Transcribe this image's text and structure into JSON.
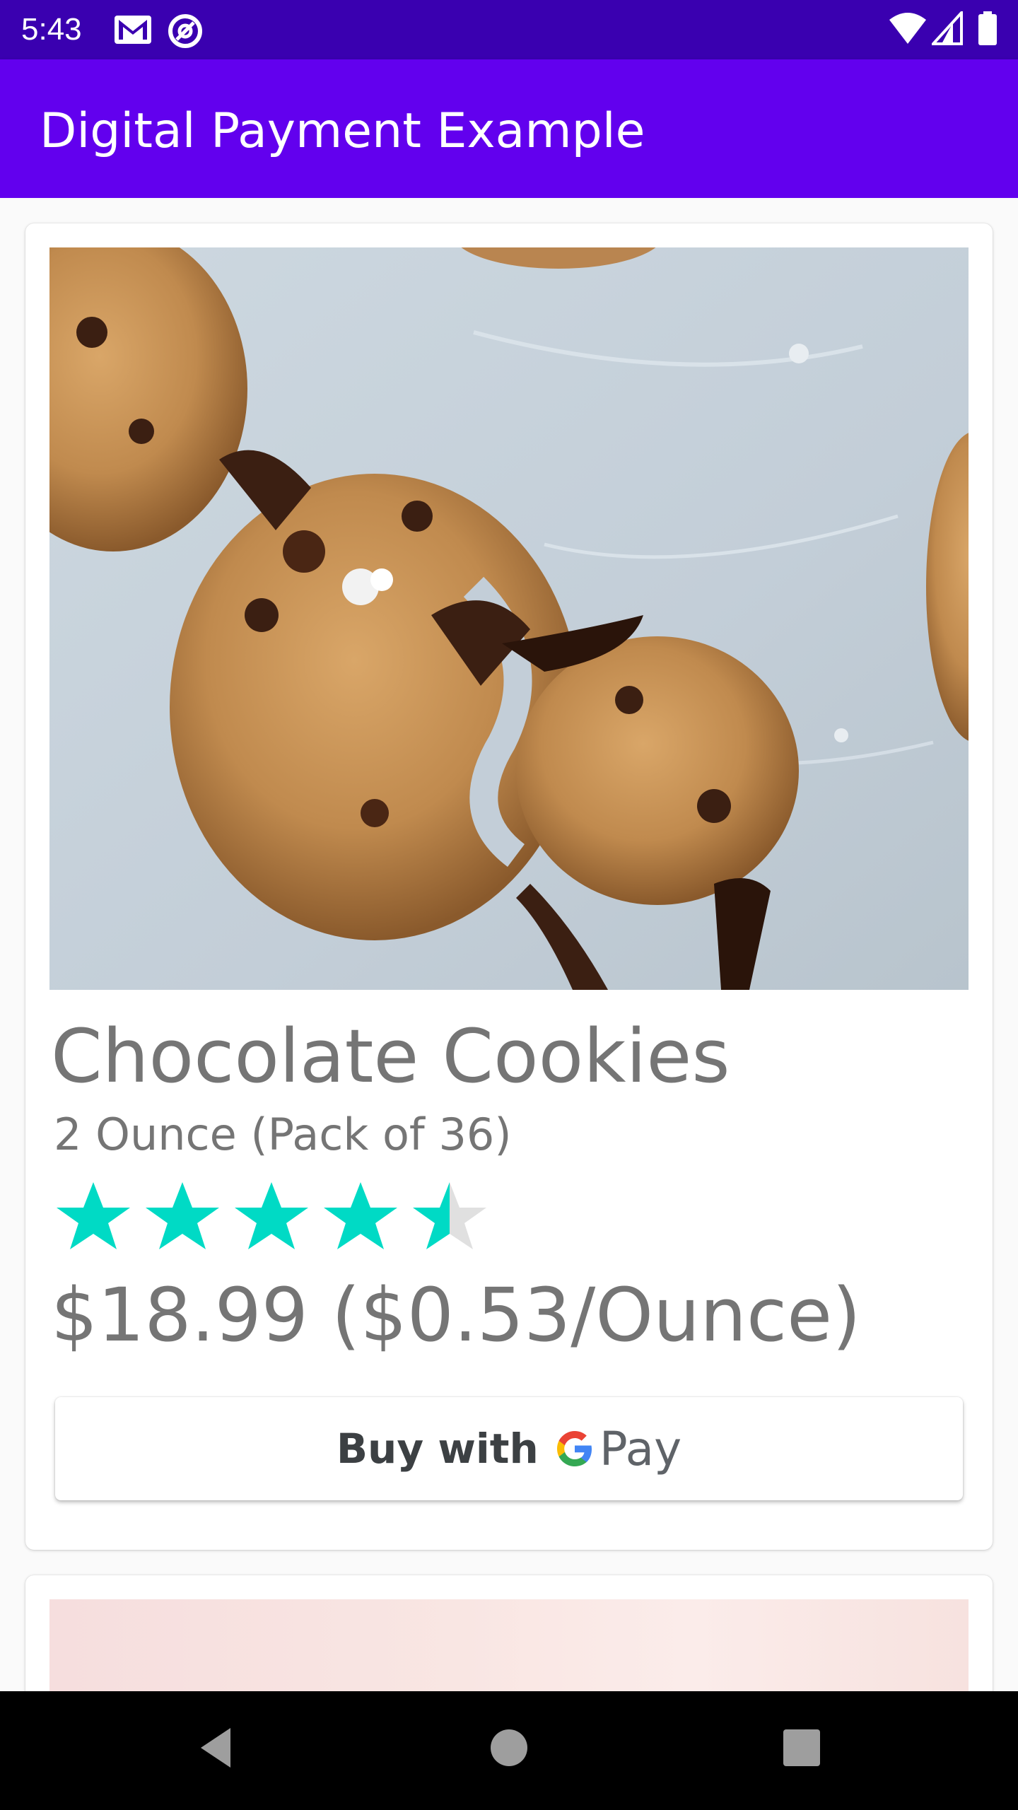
{
  "status_bar": {
    "time": "5:43",
    "left_icons": [
      "gmail-icon",
      "at-sign-icon"
    ],
    "right_icons": [
      "wifi-icon",
      "signal-icon",
      "battery-icon"
    ]
  },
  "app_bar": {
    "title": "Digital Payment Example"
  },
  "products": [
    {
      "image": "chocolate-chip-cookies-photo",
      "title": "Chocolate Cookies",
      "subtitle": "2 Ounce (Pack of 36)",
      "rating": 4.5,
      "rating_max": 5,
      "price": "$18.99 ($0.53/Ounce)",
      "buy_button": {
        "label": "Buy with",
        "brand": "Pay"
      }
    },
    {
      "image": "pink-dessert-photo"
    }
  ],
  "colors": {
    "status_bar": "#3a00b0",
    "app_bar": "#6200ee",
    "star_fill": "#00dac5",
    "star_empty": "#e0e0e0",
    "text_gray": "#757575"
  },
  "nav_bar": {
    "buttons": [
      "back-icon",
      "home-icon",
      "recents-icon"
    ]
  }
}
